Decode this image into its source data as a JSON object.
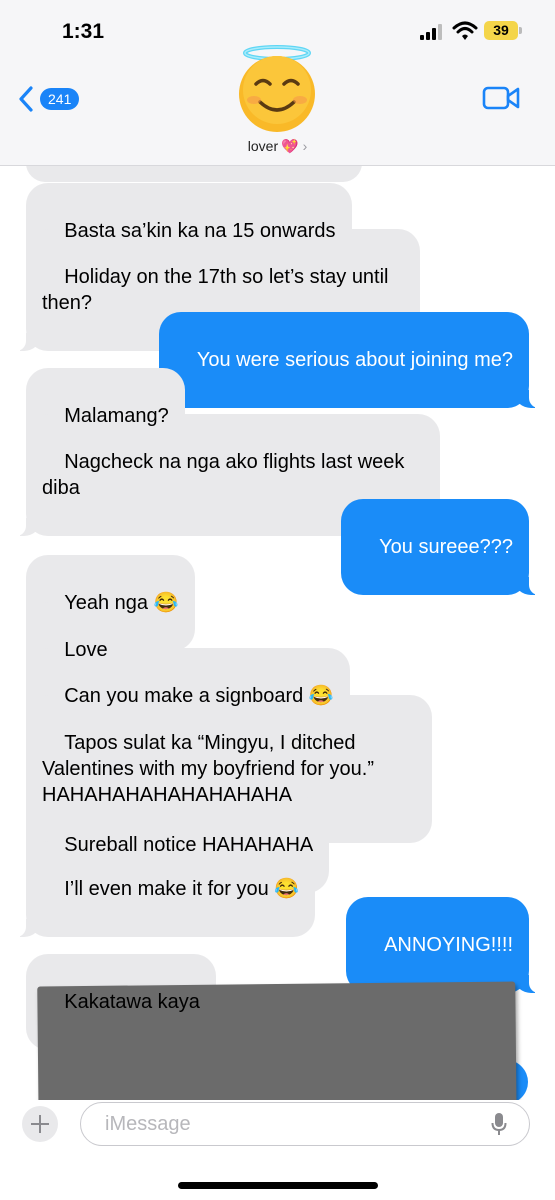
{
  "status_bar": {
    "time": "1:31",
    "battery": "39",
    "battery_color": "#f4d54a"
  },
  "header": {
    "back_count": "241",
    "contact_name": "lover",
    "contact_emoji": "💖",
    "avatar_icon": "smiling-face-with-halo",
    "accent_color": "#1a84f8"
  },
  "messages": [
    {
      "from": "them",
      "text": "Basta sa’kin ka na 15 onwards"
    },
    {
      "from": "them",
      "text": "Holiday on the 17th so let’s stay until then?"
    },
    {
      "from": "me",
      "text": "You were serious about joining me?"
    },
    {
      "from": "them",
      "text": "Malamang?"
    },
    {
      "from": "them",
      "text": "Nagcheck na nga ako flights last week diba"
    },
    {
      "from": "me",
      "text": "You sureee???"
    },
    {
      "from": "them",
      "text": "Yeah nga 😂"
    },
    {
      "from": "them",
      "text": "Love"
    },
    {
      "from": "them",
      "text": "Can you make a signboard 😂"
    },
    {
      "from": "them",
      "text": "Tapos sulat ka “Mingyu, I ditched Valentines with my boyfriend for you.” HAHAHAHAHAHAHAHAHA"
    },
    {
      "from": "them",
      "text": "Sureball notice HAHAHAHA"
    },
    {
      "from": "them",
      "text": "I’ll even make it for you 😂"
    },
    {
      "from": "me",
      "text": "ANNOYING!!!!"
    },
    {
      "from": "them",
      "text": "Kakatawa kaya"
    }
  ],
  "composer": {
    "placeholder": "iMessage"
  }
}
